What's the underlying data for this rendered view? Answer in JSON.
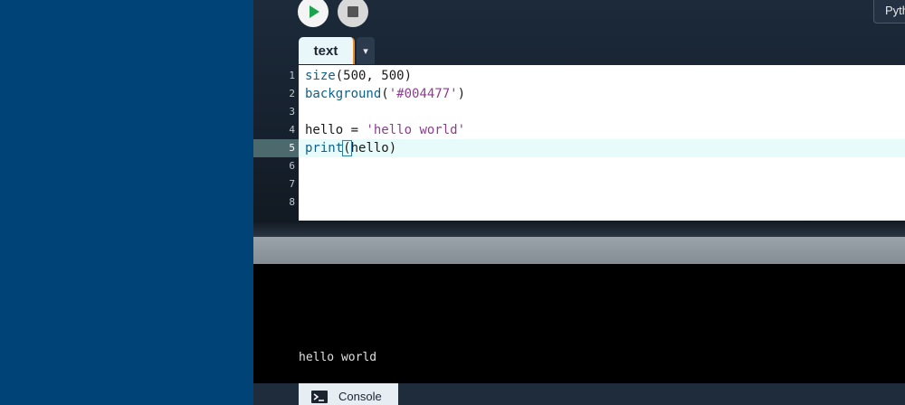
{
  "toolbar": {
    "mode_label": "Python",
    "colors": {
      "run_icon": "#1aa34a",
      "stop_icon": "#555555"
    }
  },
  "editor": {
    "tab_label": "text",
    "tab_menu_icon": "▾",
    "active_line": 5,
    "line_numbers": [
      "1",
      "2",
      "3",
      "4",
      "5",
      "6",
      "7",
      "8"
    ],
    "lines": [
      {
        "text": "size(500, 500)"
      },
      {
        "text": "background('#004477')"
      },
      {
        "text": ""
      },
      {
        "text": "hello = 'hello world'"
      },
      {
        "text": "print(hello)"
      }
    ]
  },
  "canvas": {
    "background": "#004477"
  },
  "console": {
    "output": "hello world",
    "tab_label": "Console"
  }
}
